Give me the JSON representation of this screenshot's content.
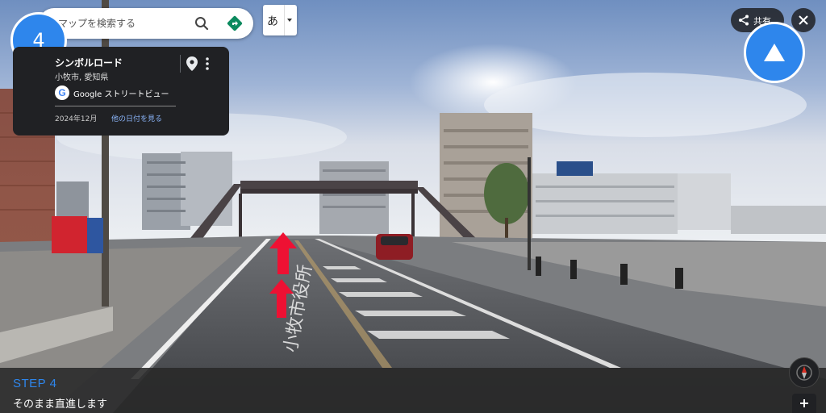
{
  "search": {
    "placeholder": "マップを検索する",
    "search_icon": "search-icon",
    "directions_icon": "directions-icon"
  },
  "ime": {
    "label": "あ",
    "dropdown_icon": "caret-down-icon"
  },
  "step_number": "4",
  "place_card": {
    "name": "シンボルロード",
    "address": "小牧市, 愛知県",
    "pin_icon": "map-pin-icon",
    "more_icon": "more-vertical-icon",
    "google_label": "Google ストリートビュー",
    "date": "2024年12月",
    "other_dates_link": "他の日付を見る"
  },
  "top_right": {
    "share_label": "共有",
    "share_icon": "share-icon",
    "close_icon": "close-icon",
    "direction_icon": "up-triangle-icon"
  },
  "step_bar": {
    "title": "STEP 4",
    "description": "そのまま直進します"
  },
  "road_marking": "小牧市役所",
  "controls": {
    "compass_icon": "compass-icon",
    "zoom_in_icon": "plus-icon"
  },
  "colors": {
    "accent_blue": "#2e86ec",
    "route_arrow_red": "#ee1133",
    "card_bg": "#202124",
    "link_blue": "#8ab4f8"
  }
}
